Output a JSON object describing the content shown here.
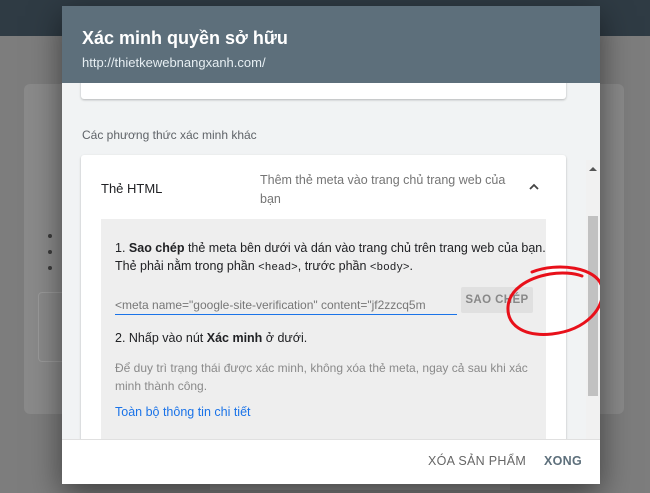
{
  "dialog": {
    "title": "Xác minh quyền sở hữu",
    "subtitle": "http://thietkewebnangxanh.com/"
  },
  "section": {
    "heading": "Các phương thức xác minh khác"
  },
  "method": {
    "title": "Thẻ HTML",
    "description": "Thêm thẻ meta vào trang chủ trang web của bạn",
    "expanded": true
  },
  "instructions": {
    "step1_prefix": "1. ",
    "step1_bold": "Sao chép",
    "step1_text": " thẻ meta bên dưới và dán vào trang chủ trên trang web của bạn. Thẻ phải nằm trong phần ",
    "step1_head": "<head>",
    "step1_mid": ", trước phần ",
    "step1_body": "<body>",
    "step1_end": ".",
    "meta_tag_value": "<meta name=\"google-site-verification\" content=\"jf2zzcq5m",
    "copy_label": "SAO CHÉP",
    "step2_prefix": "2. Nhấp vào nút ",
    "step2_bold": "Xác minh",
    "step2_suffix": " ở dưới.",
    "note": "Để duy trì trạng thái được xác minh, không xóa thẻ meta, ngay cả sau khi xác minh thành công.",
    "details_link": "Toàn bộ thông tin chi tiết"
  },
  "footer": {
    "remove_label": "XÓA SẢN PHẨM",
    "done_label": "XONG"
  },
  "colors": {
    "header_bg": "#5d6f7b",
    "link": "#1a73e8",
    "annotation": "#e8101a"
  },
  "icons": {
    "expand": "chevron-up-icon",
    "scroll": "scroll-up-icon"
  }
}
